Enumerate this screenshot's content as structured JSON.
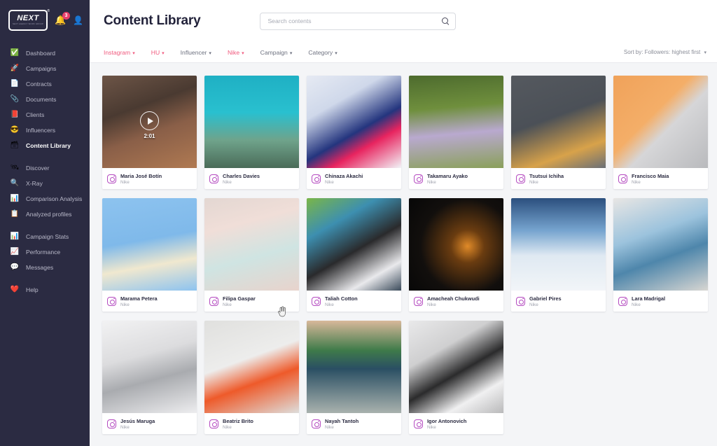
{
  "brand": {
    "logo_text": "NEXT",
    "logo_sub": "NEXT AGENCY WORK GROUP",
    "logo_reg": "®",
    "accent_pink": "#f05a7e",
    "sidebar_bg": "#2b2b42",
    "instagram_purple": "#b44ac0"
  },
  "topnav": {
    "bell_icon": "bell-icon",
    "notification_count": "3",
    "user_icon": "user-icon"
  },
  "sidebar": {
    "groups": [
      {
        "items": [
          {
            "label": "Dashboard",
            "icon": "✅",
            "icon_name": "dashboard-icon",
            "active": false
          },
          {
            "label": "Campaigns",
            "icon": "🚀",
            "icon_name": "campaigns-icon",
            "active": false
          },
          {
            "label": "Contracts",
            "icon": "📄",
            "icon_name": "contracts-icon",
            "active": false
          },
          {
            "label": "Documents",
            "icon": "📎",
            "icon_name": "documents-icon",
            "active": false
          },
          {
            "label": "Clients",
            "icon": "📕",
            "icon_name": "clients-icon",
            "active": false
          },
          {
            "label": "Influencers",
            "icon": "😎",
            "icon_name": "influencers-icon",
            "active": false
          },
          {
            "label": "Content Library",
            "icon": "🗃",
            "icon_name": "content-library-icon",
            "active": true
          }
        ]
      },
      {
        "items": [
          {
            "label": "Discover",
            "icon": "🛰",
            "icon_name": "discover-icon",
            "active": false
          },
          {
            "label": "X-Ray",
            "icon": "🔍",
            "icon_name": "xray-icon",
            "active": false
          },
          {
            "label": "Comparison Analysis",
            "icon": "📊",
            "icon_name": "comparison-analysis-icon",
            "active": false
          },
          {
            "label": "Analyzed profiles",
            "icon": "📋",
            "icon_name": "analyzed-profiles-icon",
            "active": false
          }
        ]
      },
      {
        "items": [
          {
            "label": "Campaign Stats",
            "icon": "📊",
            "icon_name": "campaign-stats-icon",
            "active": false
          },
          {
            "label": "Performance",
            "icon": "📈",
            "icon_name": "performance-icon",
            "active": false
          },
          {
            "label": "Messages",
            "icon": "💬",
            "icon_name": "messages-icon",
            "active": false
          }
        ]
      },
      {
        "items": [
          {
            "label": "Help",
            "icon": "❤️",
            "icon_name": "help-icon",
            "active": false
          }
        ]
      }
    ]
  },
  "header": {
    "title": "Content Library",
    "search": {
      "value": "",
      "placeholder": "Search contents",
      "icon": "search-icon"
    }
  },
  "filters": [
    {
      "label": "Instagram",
      "active": true
    },
    {
      "label": "HU",
      "active": true
    },
    {
      "label": "Influencer",
      "active": false
    },
    {
      "label": "Nike",
      "active": true
    },
    {
      "label": "Campaign",
      "active": false
    },
    {
      "label": "Category",
      "active": false
    }
  ],
  "sort": {
    "label": "Sort by: Followers: highest first"
  },
  "cards": [
    {
      "name": "Maria José Botín",
      "campaign": "Nike",
      "network": "instagram",
      "type": "video",
      "duration": "2:01",
      "art": "linear-gradient(160deg,#6d5547 0%,#4a3a31 35%,#8a5f48 60%,#b07a52 100%)"
    },
    {
      "name": "Charles Davies",
      "campaign": "Nike",
      "network": "instagram",
      "type": "image",
      "duration": "",
      "art": "linear-gradient(180deg,#1fb0c4 0%,#29c0cf 40%,#6fa38b 70%,#4a6b58 100%)"
    },
    {
      "name": "Chinaza Akachi",
      "campaign": "Nike",
      "network": "instagram",
      "type": "image",
      "duration": "",
      "art": "linear-gradient(150deg,#e6eaf3 0%,#cfd8ea 30%,#24357e 58%,#e8245f 72%,#f2f4f8 100%)"
    },
    {
      "name": "Takamaru Ayako",
      "campaign": "Nike",
      "network": "instagram",
      "type": "image",
      "duration": "",
      "art": "linear-gradient(175deg,#4d6b2e 0%,#6f8f3d 35%,#b9a9cf 62%,#8aa05a 100%)"
    },
    {
      "name": "Tsutsui Ichiha",
      "campaign": "Nike",
      "network": "instagram",
      "type": "image",
      "duration": "",
      "art": "linear-gradient(160deg,#55595f 0%,#4b5057 45%,#d8a24a 78%,#6a6f76 100%)"
    },
    {
      "name": "Francisco Maia",
      "campaign": "Nike",
      "network": "instagram",
      "type": "image",
      "duration": "",
      "art": "linear-gradient(135deg,#f0a25a 0%,#f4ae68 42%,#d6d6d8 58%,#b9babd 100%)"
    },
    {
      "name": "Marama Petera",
      "campaign": "Nike",
      "network": "instagram",
      "type": "image",
      "duration": "",
      "art": "linear-gradient(170deg,#8dc3ef 0%,#7fb9ea 45%,#f0e8cf 70%,#8dc3ef 100%)"
    },
    {
      "name": "Filipa Gaspar",
      "campaign": "Nike",
      "network": "instagram",
      "type": "image",
      "duration": "",
      "art": "linear-gradient(165deg,#e3d7d2 0%,#f0ded8 30%,#cfe4e2 62%,#e8d3cc 100%)"
    },
    {
      "name": "Taliah Cotton",
      "campaign": "Nike",
      "network": "instagram",
      "type": "image",
      "duration": "",
      "art": "linear-gradient(150deg,#7ab648 0%,#3d8fb0 28%,#2a2a2c 55%,#e9e9ec 80%,#3a4a5a 100%)"
    },
    {
      "name": "Amacheah Chukwudi",
      "campaign": "Nike",
      "network": "instagram",
      "type": "image",
      "duration": "",
      "art": "radial-gradient(circle at 62% 52%, #e08a28 0%, #6a3c10 22%, #120f0d 62%, #070707 100%)"
    },
    {
      "name": "Gabriel Pires",
      "campaign": "Nike",
      "network": "instagram",
      "type": "image",
      "duration": "",
      "art": "linear-gradient(180deg,#2b4f7e 0%,#76a4cf 35%,#dfe9f2 62%,#f2f5f8 100%)"
    },
    {
      "name": "Lara Madrigal",
      "campaign": "Nike",
      "network": "instagram",
      "type": "image",
      "duration": "",
      "art": "linear-gradient(160deg,#e8e6e4 0%,#9cc3dd 38%,#4e86ab 62%,#d8d6d2 100%)"
    },
    {
      "name": "Jesús Maruga",
      "campaign": "Nike",
      "network": "instagram",
      "type": "image",
      "duration": "",
      "art": "linear-gradient(165deg,#f2f2f3 0%,#dcdcde 38%,#a9abaf 62%,#ededef 100%)"
    },
    {
      "name": "Beatriz Brito",
      "campaign": "Nike",
      "network": "instagram",
      "type": "image",
      "duration": "",
      "art": "linear-gradient(160deg,#e0e0de 0%,#ededec 42%,#ee5a2a 64%,#dededc 100%)"
    },
    {
      "name": "Nayah Tantoh",
      "campaign": "Nike",
      "network": "instagram",
      "type": "image",
      "duration": "",
      "art": "linear-gradient(180deg,#d8b89a 0%,#3f7b4a 32%,#2a4f63 52%,#a9b2ae 100%)"
    },
    {
      "name": "Igor Antonovich",
      "campaign": "Nike",
      "network": "instagram",
      "type": "image",
      "duration": "",
      "art": "linear-gradient(150deg,#e9e9ea 0%,#cfcfd0 32%,#2b2b2c 55%,#f0f0f1 78%,#b9b9ba 100%)"
    }
  ],
  "cursor": {
    "icon": "pointer-hand-cursor"
  }
}
